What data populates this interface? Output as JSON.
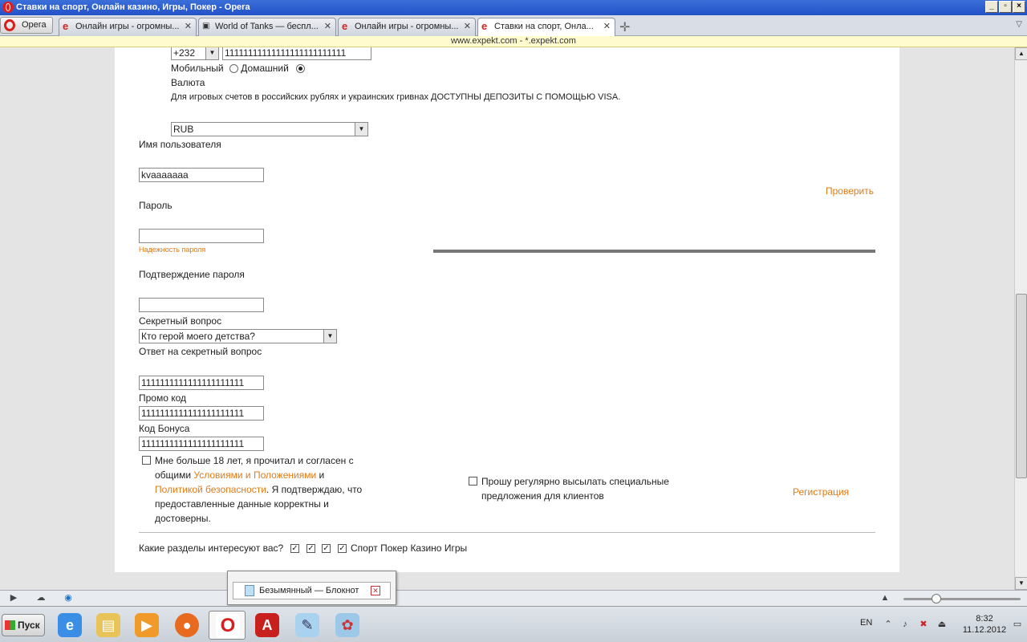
{
  "window": {
    "title": "Ставки на спорт, Онлайн казино, Игры, Покер - Opera"
  },
  "opera_button": "Opera",
  "tabs": [
    {
      "label": "Онлайн игры - огромны...",
      "favicon": "e"
    },
    {
      "label": "World of Tanks — беспл...",
      "favicon": "wot"
    },
    {
      "label": "Онлайн игры - огромны...",
      "favicon": "e"
    },
    {
      "label": "Ставки на спорт, Онла...",
      "favicon": "e"
    }
  ],
  "url_text": "www.expekt.com - *.expekt.com",
  "form": {
    "phone_code": "+232",
    "phone_number": "11111111111111111111111111",
    "mobile_label": "Мобильный",
    "home_label": "Домашний",
    "currency_label": "Валюта",
    "currency_note": "Для игровых счетов в российских рублях и украинских гривнах ДОСТУПНЫ ДЕПОЗИТЫ С ПОМОЩЬЮ VISA.",
    "currency_value": "RUB",
    "username_label": "Имя пользователя",
    "username_value": "kvaaaaaaa",
    "check_link": "Проверить",
    "password_label": "Пароль",
    "password_strength": "Надежность пароля",
    "confirm_label": "Подтверждение пароля",
    "secret_q_label": "Секретный вопрос",
    "secret_q_value": "Кто герой моего детства?",
    "secret_a_label": "Ответ на секретный вопрос",
    "secret_a_value": "1111111111111111111111",
    "promo_label": "Промо код",
    "promo_value": "1111111111111111111111",
    "bonus_label": "Код Бонуса",
    "bonus_value": "1111111111111111111111",
    "agree_line1": "Мне больше 18 лет, я прочитал и согласен с",
    "agree_line2a": "общими ",
    "agree_terms": "Условиями и Положениями",
    "agree_line2b": " и",
    "agree_privacy": "Политикой безопасности",
    "agree_line3b": ". Я подтверждаю, что",
    "agree_line4": "предоставленные данные корректны и",
    "agree_line5": "достоверны.",
    "offers_line1": "Прошу регулярно высылать специальные",
    "offers_line2": "предложения для клиентов",
    "register_link": "Регистрация",
    "interests_label": "Какие разделы интересуют вас?",
    "interests_items": "Спорт Покер Казино Игры"
  },
  "notepad_popup": {
    "label": "Безымянный — Блокнот"
  },
  "taskbar": {
    "start": "Пуск",
    "lang": "EN",
    "time": "8:32",
    "date": "11.12.2012"
  }
}
